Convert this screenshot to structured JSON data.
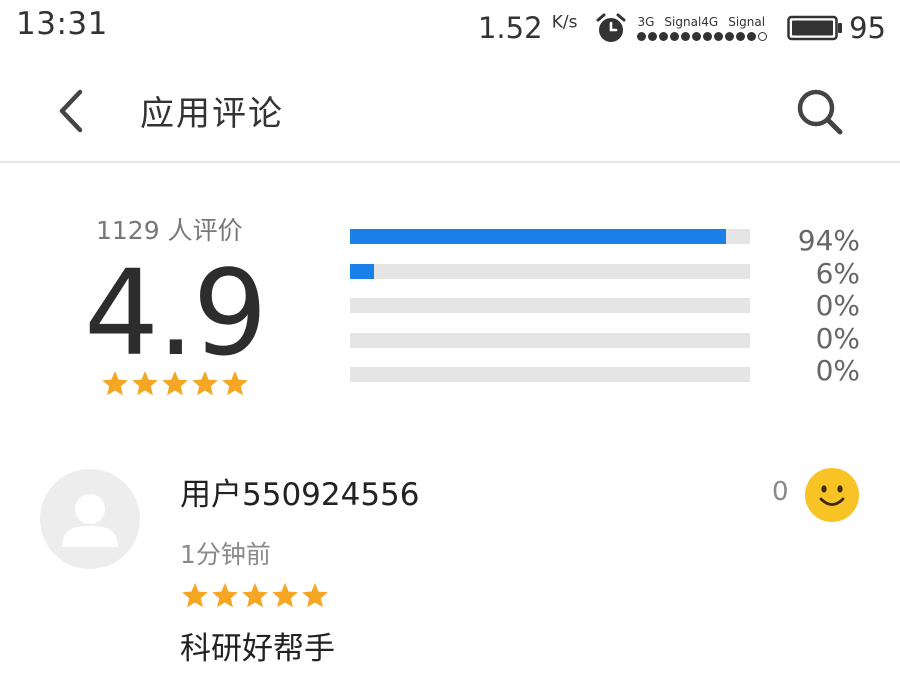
{
  "status_bar": {
    "time": "13:31",
    "net_speed": "1.52",
    "net_speed_unit": "K/s",
    "signal_label_1": "3G",
    "signal_label_2": "Signal4G",
    "signal_label_3": "Signal",
    "battery": "95",
    "icons": [
      "alarm-icon",
      "signal-dots",
      "battery-icon"
    ]
  },
  "header": {
    "title": "应用评论",
    "back_icon": "chevron-left-icon",
    "search_icon": "search-icon"
  },
  "rating": {
    "count_label": "1129 人评价",
    "score": "4.9",
    "stars": 5,
    "distribution": [
      {
        "label": "94%",
        "fraction": 0.94
      },
      {
        "label": "6%",
        "fraction": 0.06
      },
      {
        "label": "0%",
        "fraction": 0
      },
      {
        "label": "0%",
        "fraction": 0
      },
      {
        "label": "0%",
        "fraction": 0
      }
    ]
  },
  "colors": {
    "bar_fill": "#1a7fe6",
    "bar_track": "#e5e5e5",
    "star": "#f5a623",
    "smile": "#f7c325"
  },
  "review": {
    "user": "用户550924556",
    "time": "1分钟前",
    "stars": 5,
    "text": "科研好帮手",
    "likes": "0",
    "avatar_icon": "user-silhouette-icon",
    "like_icon": "smile-face-icon"
  }
}
